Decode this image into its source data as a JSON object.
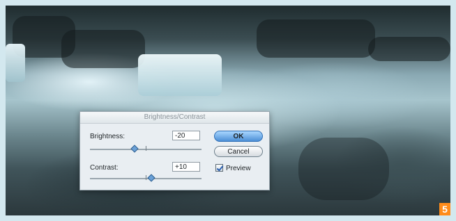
{
  "dialog": {
    "title": "Brightness/Contrast",
    "brightness": {
      "label": "Brightness:",
      "value": "-20"
    },
    "contrast": {
      "label": "Contrast:",
      "value": "+10"
    },
    "ok_label": "OK",
    "cancel_label": "Cancel",
    "preview": {
      "label": "Preview",
      "checked": true
    }
  },
  "badge": {
    "text": "5"
  },
  "colors": {
    "badge_bg": "#ff8c1a",
    "ok_button": "#4c8fd6"
  }
}
